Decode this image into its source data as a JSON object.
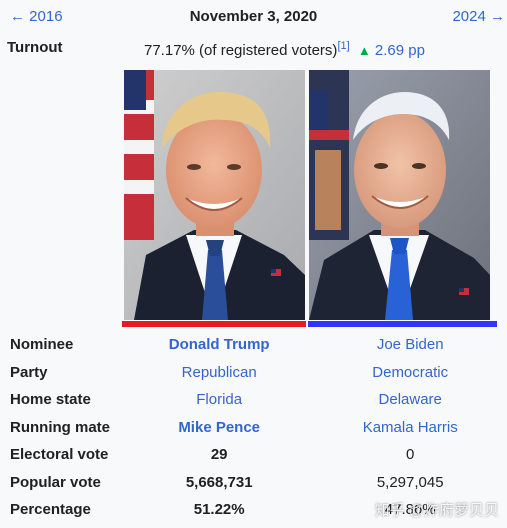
{
  "header": {
    "prev_year": "← 2016",
    "next_year": "2024 →",
    "date": "November 3, 2020"
  },
  "turnout": {
    "label": "Turnout",
    "value": "77.17% (of registered voters)",
    "ref": "[1]",
    "arrow": "▲",
    "change": "2.69 pp"
  },
  "colors": {
    "republican": "#e81b23",
    "democratic": "#3333ff",
    "link": "#3366cc"
  },
  "rows": [
    {
      "label": "Nominee",
      "c1": "Donald Trump",
      "c2": "Joe Biden"
    },
    {
      "label": "Party",
      "c1": "Republican",
      "c2": "Democratic"
    },
    {
      "label": "Home state",
      "c1": "Florida",
      "c2": "Delaware"
    },
    {
      "label": "Running mate",
      "c1": "Mike Pence",
      "c2": "Kamala Harris"
    },
    {
      "label": "Electoral vote",
      "c1": "29",
      "c2": "0"
    },
    {
      "label": "Popular vote",
      "c1": "5,668,731",
      "c2": "5,297,045"
    },
    {
      "label": "Percentage",
      "c1": "51.22%",
      "c2": "47.86%"
    }
  ],
  "watermark": "知乎 @炸府萝贝贝"
}
